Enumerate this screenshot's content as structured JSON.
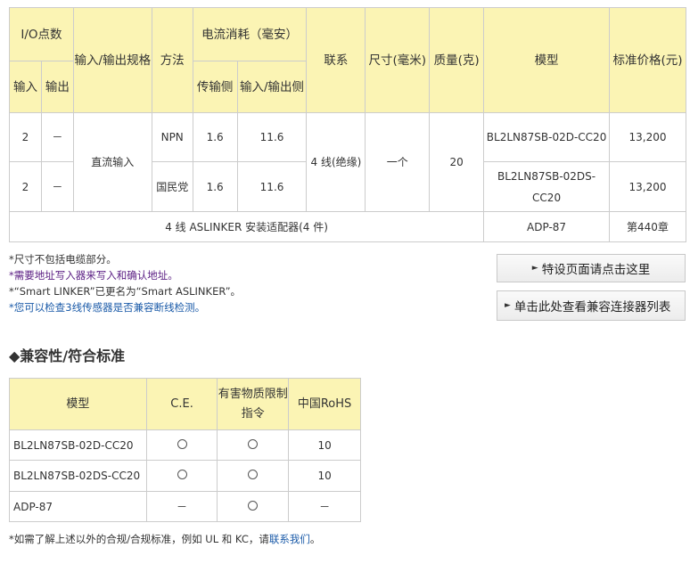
{
  "spec_table": {
    "headers": {
      "io_points": "I/O点数",
      "input": "输入",
      "output": "输出",
      "io_spec": "输入/输出规格",
      "method": "方法",
      "current": "电流消耗（毫安）",
      "transmit_side": "传输侧",
      "io_side": "输入/输出侧",
      "connection": "联系",
      "size": "尺寸(毫米)",
      "weight": "质量(克)",
      "model": "模型",
      "price": "标准价格(元)"
    },
    "rows": [
      {
        "input": "2",
        "output": "－",
        "io_spec": "直流输入",
        "method": "NPN",
        "transmit": "1.6",
        "io_current": "11.6",
        "connection": "4 线(绝缘)",
        "size": "一个",
        "weight": "20",
        "model": "BL2LN87SB-02D-CC20",
        "price": "13,200"
      },
      {
        "input": "2",
        "output": "－",
        "method": "国民党",
        "transmit": "1.6",
        "io_current": "11.6",
        "model": "BL2LN87SB-02DS-CC20",
        "price": "13,200"
      }
    ],
    "adapter_row": {
      "label": "4 线 ASLINKER 安装适配器(4 件)",
      "model": "ADP-87",
      "price": "第440章"
    }
  },
  "notes": [
    "*尺寸不包括电缆部分。",
    "*需要地址写入器来写入和确认地址。",
    "*“Smart LINKER”已更名为“Smart ASLINKER”。",
    "*您可以检查3线传感器是否兼容断线检测。"
  ],
  "buttons": {
    "special_page": "特设页面请点击这里",
    "compatible_list": "单击此处查看兼容连接器列表"
  },
  "section_title": "◆兼容性/符合标准",
  "compat_table": {
    "headers": {
      "model": "模型",
      "ce": "C.E.",
      "hazardous": "有害物质限制指令",
      "china_rohs": "中国RoHS"
    },
    "rows": [
      {
        "model": "BL2LN87SB-02D-CC20",
        "ce": "circle",
        "hazardous": "circle",
        "china_rohs": "10"
      },
      {
        "model": "BL2LN87SB-02DS-CC20",
        "ce": "circle",
        "hazardous": "circle",
        "china_rohs": "10"
      },
      {
        "model": "ADP-87",
        "ce": "－",
        "hazardous": "circle",
        "china_rohs": "－"
      }
    ]
  },
  "footer": {
    "text_before": "*如需了解上述以外的合规/合规标准，例如 UL 和 KC，请",
    "link": "联系我们",
    "text_after": "。"
  }
}
